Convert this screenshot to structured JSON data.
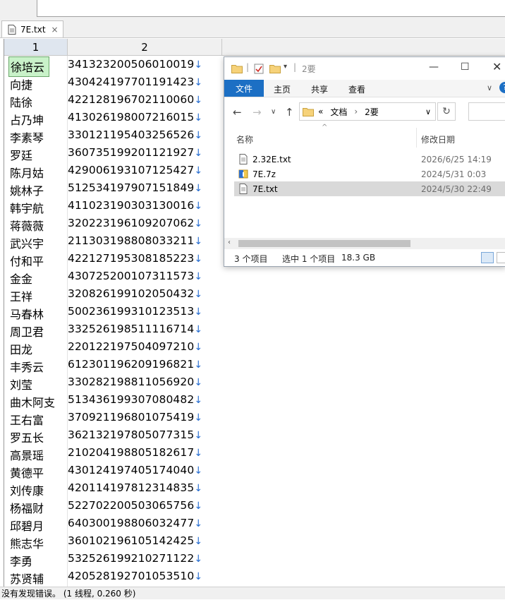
{
  "tab": {
    "label": "7E.txt",
    "close": "×"
  },
  "columns": [
    "1",
    "2"
  ],
  "rows": [
    {
      "name": "徐培云",
      "num": "341323200506010019"
    },
    {
      "name": "向捷",
      "num": "430424197701191423"
    },
    {
      "name": "陆徐",
      "num": "422128196702110060"
    },
    {
      "name": "占乃坤",
      "num": "413026198007216015"
    },
    {
      "name": "李素琴",
      "num": "330121195403256526"
    },
    {
      "name": "罗廷",
      "num": "360735199201121927"
    },
    {
      "name": "陈月姑",
      "num": "429006193107125427"
    },
    {
      "name": "姚林子",
      "num": "512534197907151849"
    },
    {
      "name": "韩宇航",
      "num": "411023190303130016"
    },
    {
      "name": "蒋薇薇",
      "num": "320223196109207062"
    },
    {
      "name": "武兴宇",
      "num": "211303198808033211"
    },
    {
      "name": "付和平",
      "num": "422127195308185223"
    },
    {
      "name": "金金",
      "num": "430725200107311573"
    },
    {
      "name": "王祥",
      "num": "320826199102050432"
    },
    {
      "name": "马春林",
      "num": "500236199310123513"
    },
    {
      "name": "周卫君",
      "num": "332526198511116714"
    },
    {
      "name": "田龙",
      "num": "220122197504097210"
    },
    {
      "name": "丰秀云",
      "num": "612301196209196821"
    },
    {
      "name": "刘莹",
      "num": "330282198811056920"
    },
    {
      "name": "曲木阿支",
      "num": "513436199307080482"
    },
    {
      "name": "王右富",
      "num": "370921196801075419"
    },
    {
      "name": "罗五长",
      "num": "362132197805077315"
    },
    {
      "name": "高景瑶",
      "num": "210204198805182617"
    },
    {
      "name": "黄德平",
      "num": "430124197405174040"
    },
    {
      "name": "刘传康",
      "num": "420114197812314835"
    },
    {
      "name": "杨福财",
      "num": "522702200503065756"
    },
    {
      "name": "邱碧月",
      "num": "640300198806032477"
    },
    {
      "name": "熊志华",
      "num": "360102196105142425"
    },
    {
      "name": "李勇",
      "num": "532526199210271122"
    },
    {
      "name": "苏贤辅",
      "num": "420528192701053510"
    }
  ],
  "line_end_mark": "↓",
  "explorer": {
    "title": "2要",
    "ribbon": [
      "文件",
      "主页",
      "共享",
      "查看"
    ],
    "breadcrumb": [
      "«",
      "文档",
      "›",
      "2要"
    ],
    "col_name": "名称",
    "col_date": "修改日期",
    "files": [
      {
        "name": "2.32E.txt",
        "date": "2026/6/25 14:19",
        "icon": "text-file-icon"
      },
      {
        "name": "7E.7z",
        "date": "2024/5/31 0:03",
        "icon": "archive-icon"
      },
      {
        "name": "7E.txt",
        "date": "2024/5/30 22:49",
        "icon": "text-file-icon"
      }
    ],
    "status_count": "3 个项目",
    "status_selected": "选中 1 个项目",
    "status_size": "18.3 GB"
  },
  "statusbar": {
    "text": "没有发现错误。 (1 线程, 0.260 秒)"
  },
  "colors": {
    "accent": "#1c6fc4",
    "selected_cell": "#c9f2c9",
    "arrow": "#2a6fd1"
  }
}
